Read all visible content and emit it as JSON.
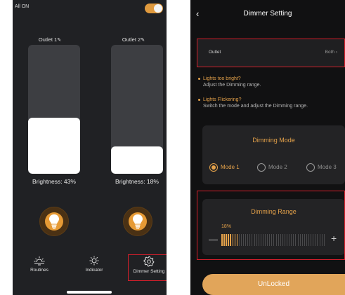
{
  "left_screen": {
    "all_on_label": "All ON",
    "all_on_toggle": true,
    "outlets": [
      {
        "title": "Outlet 1",
        "brightness_label": "Brightness: 43%",
        "brightness": 0.43
      },
      {
        "title": "Outlet 2",
        "brightness_label": "Brightness: 18%",
        "brightness": 0.18
      }
    ],
    "nav": {
      "routines": "Routines",
      "indicator": "Indicator",
      "dimmer_setting": "Dimmer Setting"
    }
  },
  "right_screen": {
    "title": "Dimmer Setting",
    "outlet_row": {
      "label": "Outlet",
      "value": "Both"
    },
    "tips": [
      {
        "question": "Lights too bright?",
        "answer": "Adjust the Dimming range."
      },
      {
        "question": "Lights Flickering?",
        "answer": "Switch the mode and adjust the Dimming range."
      }
    ],
    "dimming_mode": {
      "title": "Dimming Mode",
      "options": [
        "Mode 1",
        "Mode 2",
        "Mode 3"
      ],
      "selected": "Mode 1"
    },
    "dimming_range": {
      "title": "Dimming Range",
      "value_label": "18%",
      "value": 0.18,
      "minus": "—",
      "plus": "+"
    },
    "unlock_button": "UnLocked"
  },
  "colors": {
    "accent": "#e5a24a",
    "highlight_border": "#d61f2b",
    "button": "#e1a55a"
  }
}
